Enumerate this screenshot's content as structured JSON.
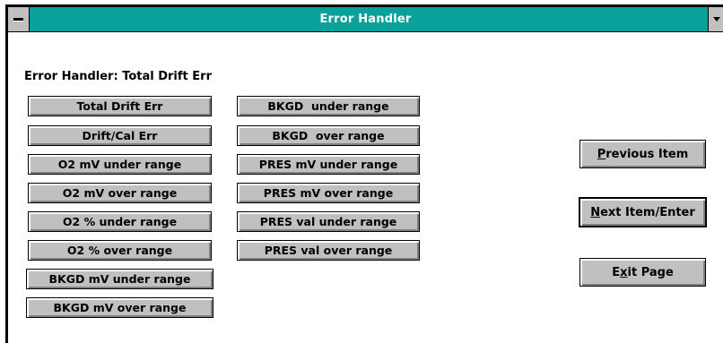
{
  "window": {
    "title": "Error Handler"
  },
  "handler_label": "Error Handler: Total Drift Err",
  "left_buttons": [
    "Total Drift Err",
    "Drift/Cal Err",
    "O2 mV under range",
    "O2 mV over range",
    "O2 % under range",
    "O2 % over range",
    "BKGD mV under range",
    "BKGD mV over range"
  ],
  "right_buttons": [
    "BKGD  under range",
    "BKGD  over range",
    "PRES mV under range",
    "PRES mV over range",
    "PRES val under range",
    "PRES val over range"
  ],
  "nav": {
    "previous": {
      "mnemonic": "P",
      "rest": "revious Item"
    },
    "next": {
      "mnemonic": "N",
      "rest": "ext Item/Enter"
    },
    "exit": {
      "pre": "E",
      "mnemonic": "x",
      "rest": "it Page"
    }
  }
}
